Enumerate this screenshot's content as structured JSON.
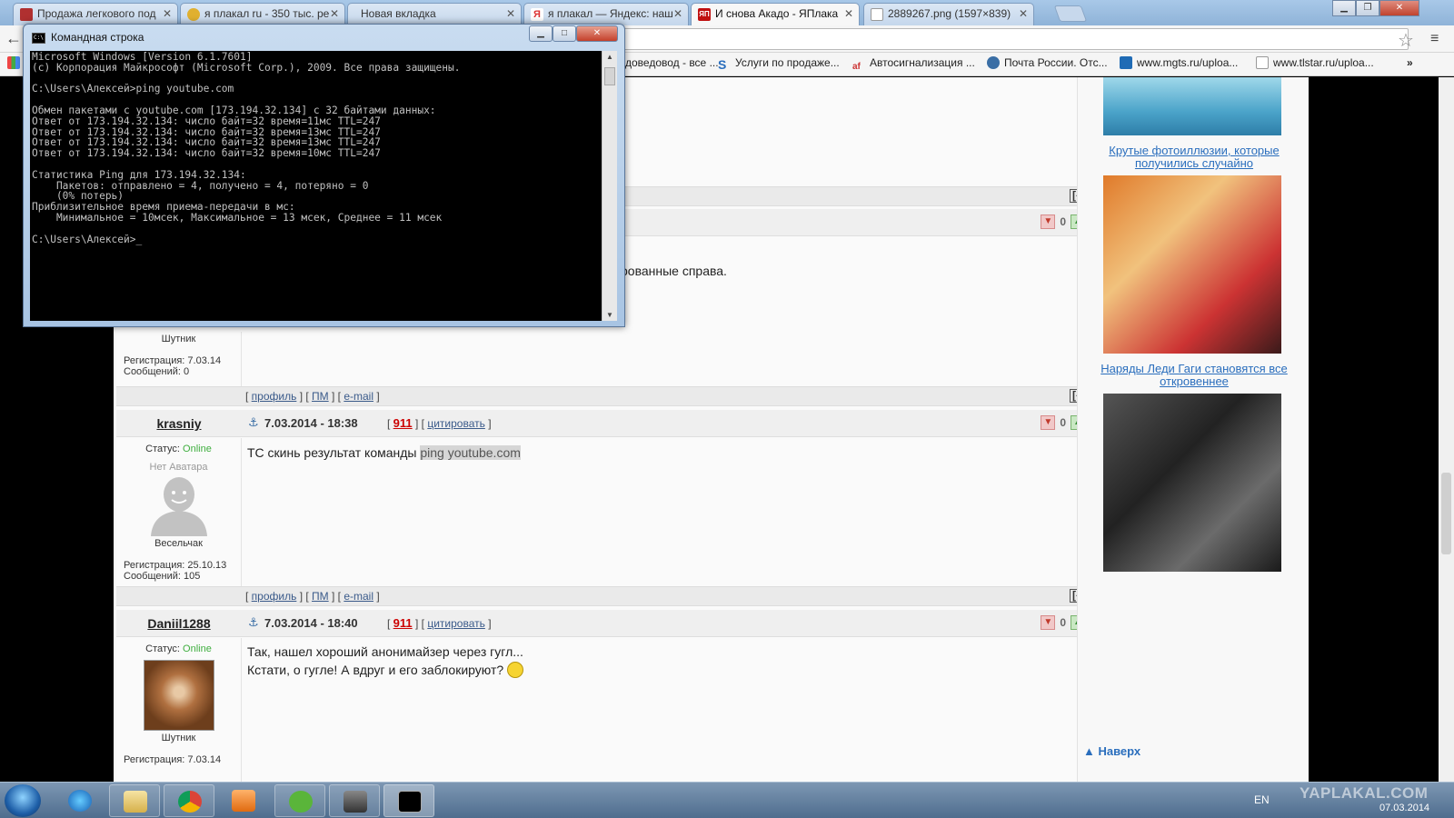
{
  "browser": {
    "tabs": [
      {
        "label": "Продажа легкового под",
        "color": "#b03030"
      },
      {
        "label": "я плакал ru - 350 тыс. ре",
        "color": "#e0b030"
      },
      {
        "label": "Новая вкладка",
        "color": ""
      },
      {
        "label": "я плакал — Яндекс: наш",
        "color": "#d33"
      },
      {
        "label": "И снова Акадо - ЯПлака",
        "color": "#c01010"
      },
      {
        "label": "2889267.png (1597×839)",
        "color": "#ddd"
      }
    ],
    "bookmarks": [
      {
        "label": "доведовод - все ...",
        "color": ""
      },
      {
        "label": "Услуги по продаже...",
        "color": "#2a6ebd"
      },
      {
        "label": "Автосигнализация ...",
        "color": "#c33"
      },
      {
        "label": "Почта России. Отс...",
        "color": "#3a6ea5"
      },
      {
        "label": "www.mgts.ru/uploa...",
        "color": "#1f6bb5"
      },
      {
        "label": "www.tlstar.ru/uploa...",
        "color": "#ccc"
      }
    ],
    "more": "»"
  },
  "cmd": {
    "title": "Командная строка",
    "icon_text": "C:\\",
    "lines": "Microsoft Windows [Version 6.1.7601]\n(c) Корпорация Майкрософт (Microsoft Corp.), 2009. Все права защищены.\n\nC:\\Users\\Алексей>ping youtube.com\n\nОбмен пакетами с youtube.com [173.194.32.134] с 32 байтами данных:\nОтвет от 173.194.32.134: число байт=32 время=11мс TTL=247\nОтвет от 173.194.32.134: число байт=32 время=13мс TTL=247\nОтвет от 173.194.32.134: число байт=32 время=13мс TTL=247\nОтвет от 173.194.32.134: число байт=32 время=10мс TTL=247\n\nСтатистика Ping для 173.194.32.134:\n    Пакетов: отправлено = 4, получено = 4, потеряно = 0\n    (0% потерь)\nПриблизительное время приема-передачи в мс:\n    Минимальное = 10мсек, Максимальное = 13 мсек, Среднее = 11 мсек\n\nC:\\Users\\Алексей>_"
  },
  "forum": {
    "partial_text": "рованные справа.",
    "post1": {
      "rank": "Шутник",
      "reg": "Регистрация: 7.03.14",
      "msgs": "Сообщений: 0",
      "score": "0"
    },
    "bar_links": {
      "profile": "профиль",
      "pm": "ПМ",
      "email": "e-mail"
    },
    "up_label": "[^]",
    "post2": {
      "author": "krasniy",
      "date": "7.03.2014 - 18:38",
      "num": "911",
      "cite": "цитировать",
      "status_label": "Статус:",
      "status": "Online",
      "no_avatar": "Нет Аватара",
      "rank": "Весельчак",
      "reg": "Регистрация: 25.10.13",
      "msgs": "Сообщений: 105",
      "text_prefix": "ТС скинь результат команды ",
      "text_highlight": "ping youtube.com",
      "score": "0"
    },
    "post3": {
      "author": "Daniil1288",
      "date": "7.03.2014 - 18:40",
      "num": "911",
      "cite": "цитировать",
      "status_label": "Статус:",
      "status": "Online",
      "rank": "Шутник",
      "reg": "Регистрация: 7.03.14",
      "line1": "Так, нашел хороший анонимайзер через гугл...",
      "line2": "Кстати, о гугле! А вдруг и его заблокируют?",
      "score": "0"
    }
  },
  "sidebar": {
    "link1": "Крутые фотоиллюзии, которые получились случайно",
    "link2": "Наряды Леди Гаги становятся все откровеннее",
    "to_top": "Наверх"
  },
  "taskbar": {
    "lang": "EN",
    "date": "07.03.2014",
    "watermark": "YAPLAKAL.COM"
  }
}
